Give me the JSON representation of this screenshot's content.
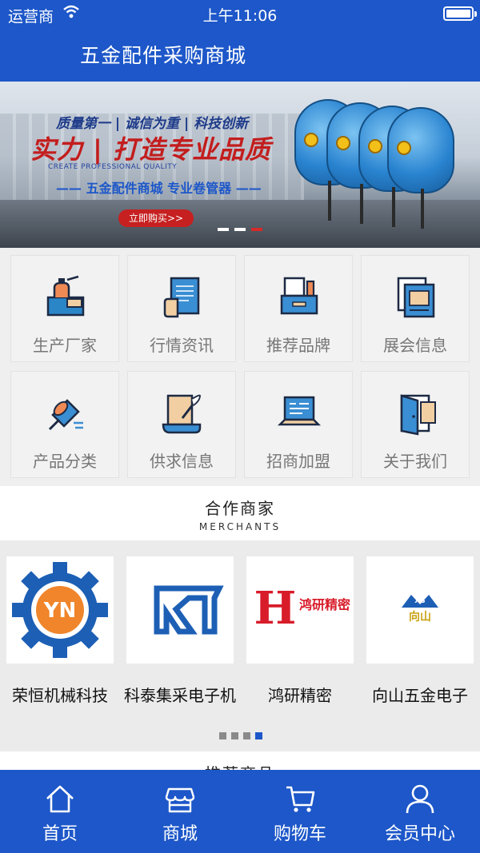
{
  "status_bar": {
    "carrier": "运营商",
    "time": "上午11:06"
  },
  "header": {
    "title": "五金配件采购商城"
  },
  "banner": {
    "slogan": "质量第一 | 诚信为重 | 科技创新",
    "headline": "实力 | 打造专业品质",
    "subtitle_en": "CREATE PROFESSIONAL QUALITY",
    "tagline": "——  五金配件商城  专业卷管器  ——",
    "button": "立即购买>>",
    "slides": 3,
    "active_slide": 3
  },
  "grid": [
    {
      "label": "生产厂家",
      "icon": "factory-icon"
    },
    {
      "label": "行情资讯",
      "icon": "news-scroll-icon"
    },
    {
      "label": "推荐品牌",
      "icon": "brand-drawer-icon"
    },
    {
      "label": "展会信息",
      "icon": "exhibition-icon"
    },
    {
      "label": "产品分类",
      "icon": "pin-icon"
    },
    {
      "label": "供求信息",
      "icon": "quill-scroll-icon"
    },
    {
      "label": "招商加盟",
      "icon": "laptop-icon"
    },
    {
      "label": "关于我们",
      "icon": "door-icon"
    }
  ],
  "merchants": {
    "title": "合作商家",
    "subtitle": "MERCHANTS",
    "items": [
      {
        "name": "荣恒机械科技",
        "logo": "YN"
      },
      {
        "name": "科泰集采电子机",
        "logo": "KT"
      },
      {
        "name": "鸿研精密",
        "logo": "H",
        "logo_text": "鸿研精密"
      },
      {
        "name": "向山五金电子",
        "logo": "XS",
        "logo_text": "向山"
      }
    ],
    "pages": 4,
    "active_page": 4
  },
  "next_section_title": "推荐商品",
  "tabbar": [
    {
      "label": "首页",
      "icon": "home-icon"
    },
    {
      "label": "商城",
      "icon": "store-icon"
    },
    {
      "label": "购物车",
      "icon": "cart-icon"
    },
    {
      "label": "会员中心",
      "icon": "user-icon"
    }
  ],
  "colors": {
    "primary": "#1d57c9",
    "accent_red": "#c31d1d",
    "grey_text": "#777777"
  }
}
